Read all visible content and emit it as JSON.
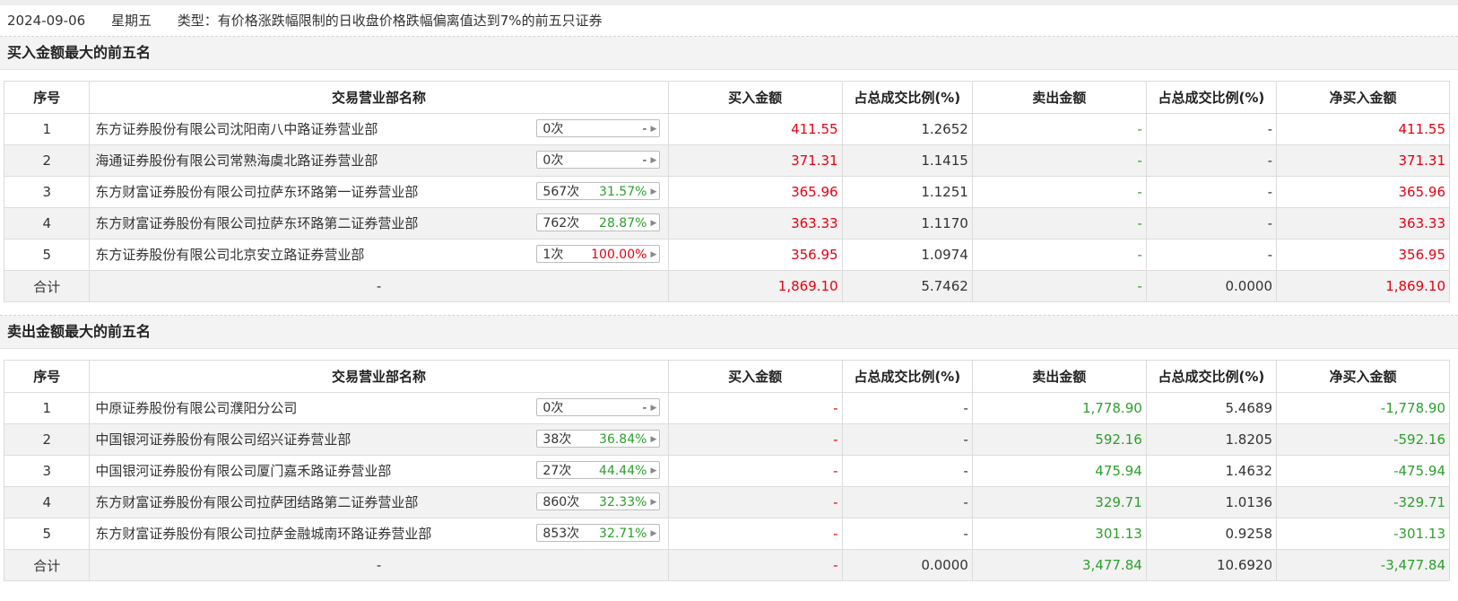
{
  "info": {
    "date": "2024-09-06",
    "weekday": "星期五",
    "type": "类型：有价格涨跌幅限制的日收盘价格跌幅偏离值达到7%的前五只证券"
  },
  "headers": [
    "序号",
    "交易营业部名称",
    "买入金额",
    "占总成交比例(%)",
    "卖出金额",
    "占总成交比例(%)",
    "净买入金额"
  ],
  "buy": {
    "title": "买入金额最大的前五名",
    "rows": [
      {
        "idx": "1",
        "name": "东方证券股份有限公司沈阳南八中路证券营业部",
        "times": "0次",
        "pct": "-",
        "pct_color": "#333333",
        "buy": "411.55",
        "buy_ratio": "1.2652",
        "sell": "-",
        "sell_ratio": "-",
        "net": "411.55"
      },
      {
        "idx": "2",
        "name": "海通证券股份有限公司常熟海虞北路证券营业部",
        "times": "0次",
        "pct": "-",
        "pct_color": "#333333",
        "buy": "371.31",
        "buy_ratio": "1.1415",
        "sell": "-",
        "sell_ratio": "-",
        "net": "371.31"
      },
      {
        "idx": "3",
        "name": "东方财富证券股份有限公司拉萨东环路第一证券营业部",
        "times": "567次",
        "pct": "31.57%",
        "pct_color": "#2ca02c",
        "buy": "365.96",
        "buy_ratio": "1.1251",
        "sell": "-",
        "sell_ratio": "-",
        "net": "365.96"
      },
      {
        "idx": "4",
        "name": "东方财富证券股份有限公司拉萨东环路第二证券营业部",
        "times": "762次",
        "pct": "28.87%",
        "pct_color": "#2ca02c",
        "buy": "363.33",
        "buy_ratio": "1.1170",
        "sell": "-",
        "sell_ratio": "-",
        "net": "363.33"
      },
      {
        "idx": "5",
        "name": "东方证券股份有限公司北京安立路证券营业部",
        "times": "1次",
        "pct": "100.00%",
        "pct_color": "#e60012",
        "buy": "356.95",
        "buy_ratio": "1.0974",
        "sell": "-",
        "sell_ratio": "-",
        "net": "356.95"
      }
    ],
    "total": {
      "label": "合计",
      "name": "-",
      "buy": "1,869.10",
      "buy_ratio": "5.7462",
      "sell": "-",
      "sell_ratio": "0.0000",
      "net": "1,869.10"
    }
  },
  "sell": {
    "title": "卖出金额最大的前五名",
    "rows": [
      {
        "idx": "1",
        "name": "中原证券股份有限公司濮阳分公司",
        "times": "0次",
        "pct": "-",
        "pct_color": "#333333",
        "buy": "-",
        "buy_ratio": "-",
        "sell": "1,778.90",
        "sell_ratio": "5.4689",
        "net": "-1,778.90"
      },
      {
        "idx": "2",
        "name": "中国银河证券股份有限公司绍兴证券营业部",
        "times": "38次",
        "pct": "36.84%",
        "pct_color": "#2ca02c",
        "buy": "-",
        "buy_ratio": "-",
        "sell": "592.16",
        "sell_ratio": "1.8205",
        "net": "-592.16"
      },
      {
        "idx": "3",
        "name": "中国银河证券股份有限公司厦门嘉禾路证券营业部",
        "times": "27次",
        "pct": "44.44%",
        "pct_color": "#2ca02c",
        "buy": "-",
        "buy_ratio": "-",
        "sell": "475.94",
        "sell_ratio": "1.4632",
        "net": "-475.94"
      },
      {
        "idx": "4",
        "name": "东方财富证券股份有限公司拉萨团结路第二证券营业部",
        "times": "860次",
        "pct": "32.33%",
        "pct_color": "#2ca02c",
        "buy": "-",
        "buy_ratio": "-",
        "sell": "329.71",
        "sell_ratio": "1.0136",
        "net": "-329.71"
      },
      {
        "idx": "5",
        "name": "东方财富证券股份有限公司拉萨金融城南环路证券营业部",
        "times": "853次",
        "pct": "32.71%",
        "pct_color": "#2ca02c",
        "buy": "-",
        "buy_ratio": "-",
        "sell": "301.13",
        "sell_ratio": "0.9258",
        "net": "-301.13"
      }
    ],
    "total": {
      "label": "合计",
      "name": "-",
      "buy": "-",
      "buy_ratio": "0.0000",
      "sell": "3,477.84",
      "sell_ratio": "10.6920",
      "net": "-3,477.84"
    }
  },
  "colors": {
    "up": "#e60012",
    "down": "#2ca02c"
  }
}
